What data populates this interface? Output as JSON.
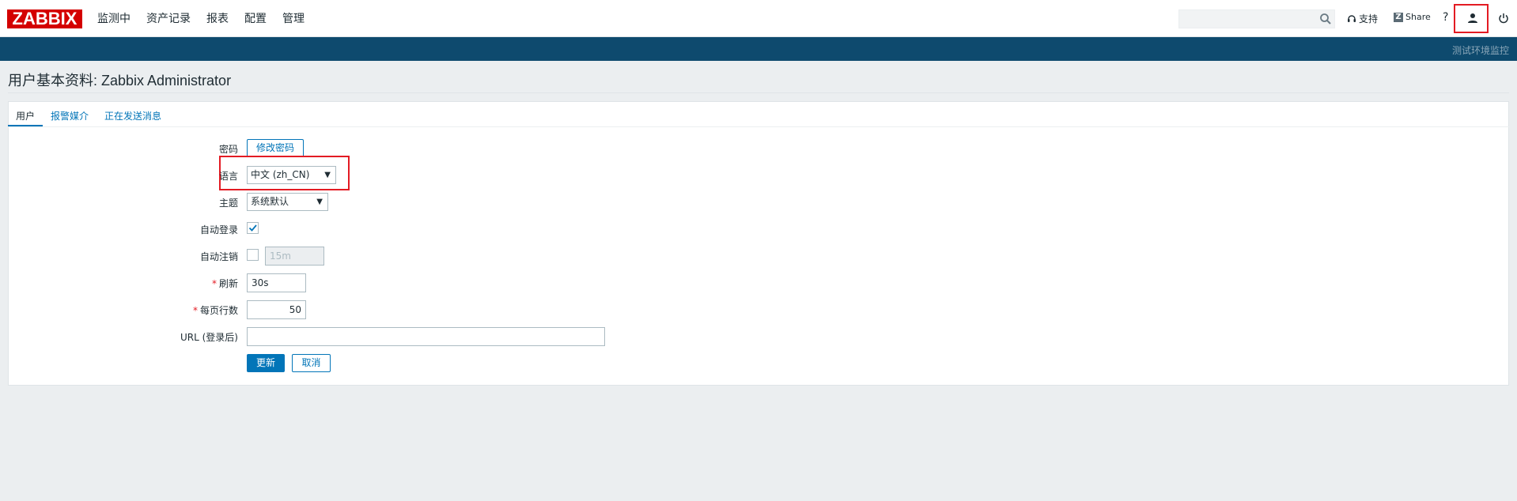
{
  "header": {
    "logo": "ZABBIX",
    "menu": [
      "监测中",
      "资产记录",
      "报表",
      "配置",
      "管理"
    ],
    "search_placeholder": "",
    "support_label": "支持",
    "share_label": "Share",
    "share_badge": "Z",
    "help_label": "?"
  },
  "bluebar": {
    "server_name": "测试环境监控"
  },
  "page": {
    "title": "用户基本资料: Zabbix Administrator"
  },
  "tabs": [
    {
      "label": "用户",
      "active": true
    },
    {
      "label": "报警媒介",
      "active": false
    },
    {
      "label": "正在发送消息",
      "active": false
    }
  ],
  "form": {
    "password_label": "密码",
    "change_password_button": "修改密码",
    "language_label": "语言",
    "language_value": "中文 (zh_CN)",
    "theme_label": "主题",
    "theme_value": "系统默认",
    "autologin_label": "自动登录",
    "autologin_checked": true,
    "autologout_label": "自动注销",
    "autologout_checked": false,
    "autologout_value": "15m",
    "refresh_label": "刷新",
    "refresh_value": "30s",
    "rows_label": "每页行数",
    "rows_value": "50",
    "url_label": "URL (登录后)",
    "url_value": "",
    "update_button": "更新",
    "cancel_button": "取消"
  },
  "colors": {
    "logo_bg": "#d40000",
    "nav_bar": "#0e4a6e",
    "accent": "#0275b8",
    "highlight": "#e31b23"
  }
}
